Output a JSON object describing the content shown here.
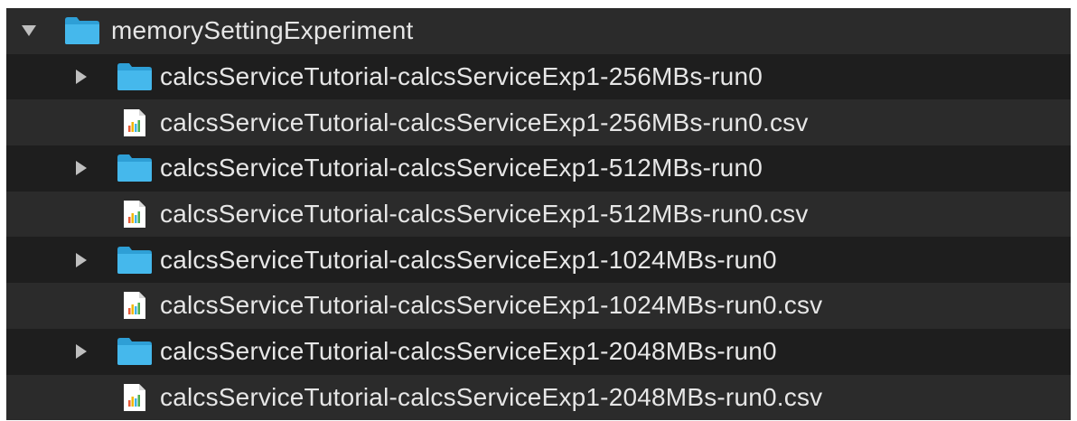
{
  "colors": {
    "background": "#1e1e1e",
    "row_alt": "#2b2b2b",
    "text": "#e6e6e6",
    "folder": "#3fb3e8",
    "disclosure": "#bfbfbf"
  },
  "root": {
    "name": "memorySettingExperiment",
    "expanded": true,
    "icon": "folder-icon"
  },
  "items": [
    {
      "type": "folder",
      "name": "calcsServiceTutorial-calcsServiceExp1-256MBs-run0",
      "expanded": false,
      "icon": "folder-icon"
    },
    {
      "type": "file",
      "name": "calcsServiceTutorial-calcsServiceExp1-256MBs-run0.csv",
      "icon": "csv-file-icon"
    },
    {
      "type": "folder",
      "name": "calcsServiceTutorial-calcsServiceExp1-512MBs-run0",
      "expanded": false,
      "icon": "folder-icon"
    },
    {
      "type": "file",
      "name": "calcsServiceTutorial-calcsServiceExp1-512MBs-run0.csv",
      "icon": "csv-file-icon"
    },
    {
      "type": "folder",
      "name": "calcsServiceTutorial-calcsServiceExp1-1024MBs-run0",
      "expanded": false,
      "icon": "folder-icon"
    },
    {
      "type": "file",
      "name": "calcsServiceTutorial-calcsServiceExp1-1024MBs-run0.csv",
      "icon": "csv-file-icon"
    },
    {
      "type": "folder",
      "name": "calcsServiceTutorial-calcsServiceExp1-2048MBs-run0",
      "expanded": false,
      "icon": "folder-icon"
    },
    {
      "type": "file",
      "name": "calcsServiceTutorial-calcsServiceExp1-2048MBs-run0.csv",
      "icon": "csv-file-icon"
    }
  ]
}
